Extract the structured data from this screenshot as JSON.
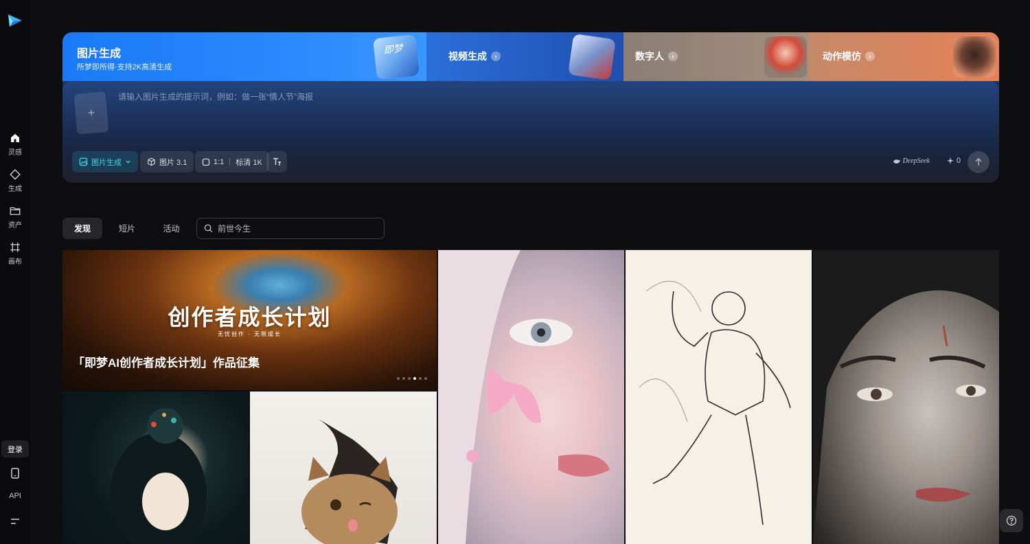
{
  "sidebar": {
    "logo_icon": "jimeng-logo-icon",
    "items": [
      {
        "label": "灵感",
        "icon": "home-icon"
      },
      {
        "label": "生成",
        "icon": "diamond-icon"
      },
      {
        "label": "资产",
        "icon": "folder-icon"
      },
      {
        "label": "画布",
        "icon": "canvas-icon"
      }
    ],
    "login_label": "登录",
    "mobile_icon": "mobile-icon",
    "api_label": "API",
    "menu_icon": "menu-icon"
  },
  "hero": {
    "title": "图片生成",
    "subtitle": "所梦即所得·支持2K高清生成",
    "tabs": [
      {
        "label": "视频生成"
      },
      {
        "label": "数字人"
      },
      {
        "label": "动作模仿"
      }
    ],
    "thumb_text": "即梦"
  },
  "prompt": {
    "placeholder": "请输入图片生成的提示词，例如：做一张“情人节”海报",
    "upload_symbol": "+",
    "tools": {
      "mode_label": "图片生成",
      "model_label": "图片 3.1",
      "ratio_label": "1:1",
      "quality_label": "标清 1K"
    },
    "deepseek_label": "DeepSeek",
    "credits": "0"
  },
  "feed": {
    "tabs": [
      "发现",
      "短片",
      "活动"
    ],
    "active_tab": "发现",
    "search_placeholder": "前世今生"
  },
  "banner": {
    "headline": "创作者成长计划",
    "tagline": "无忧创作 · 无限成长",
    "caption": "「即梦AI创作者成长计划」作品征集",
    "slide_count": 6,
    "active_slide": 4
  },
  "colors": {
    "accent": "#3fd3ea",
    "brand_blue": "#1a7af5",
    "background": "#0e0e11"
  }
}
